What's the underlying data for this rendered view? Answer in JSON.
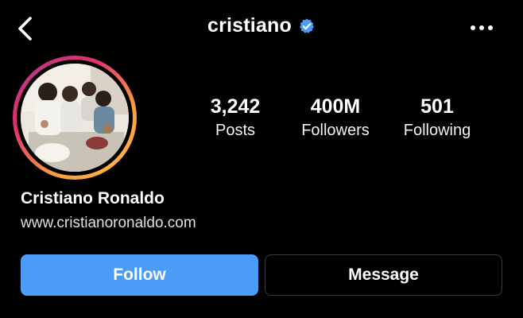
{
  "header": {
    "username": "cristiano",
    "verified_icon": "verified-badge-icon",
    "back_icon": "chevron-left-icon",
    "more_icon": "more-horizontal-icon",
    "accent_verified": "#4a9cf7"
  },
  "profile": {
    "avatar": "profile-photo",
    "story_ring_colors": [
      "#f9a03f",
      "#e1306c",
      "#c13584"
    ],
    "full_name": "Cristiano Ronaldo",
    "website": "www.cristianoronaldo.com"
  },
  "stats": [
    {
      "value": "3,242",
      "label": "Posts"
    },
    {
      "value": "400M",
      "label": "Followers"
    },
    {
      "value": "501",
      "label": "Following"
    }
  ],
  "actions": {
    "follow_label": "Follow",
    "message_label": "Message",
    "follow_color": "#4a9cf7"
  }
}
